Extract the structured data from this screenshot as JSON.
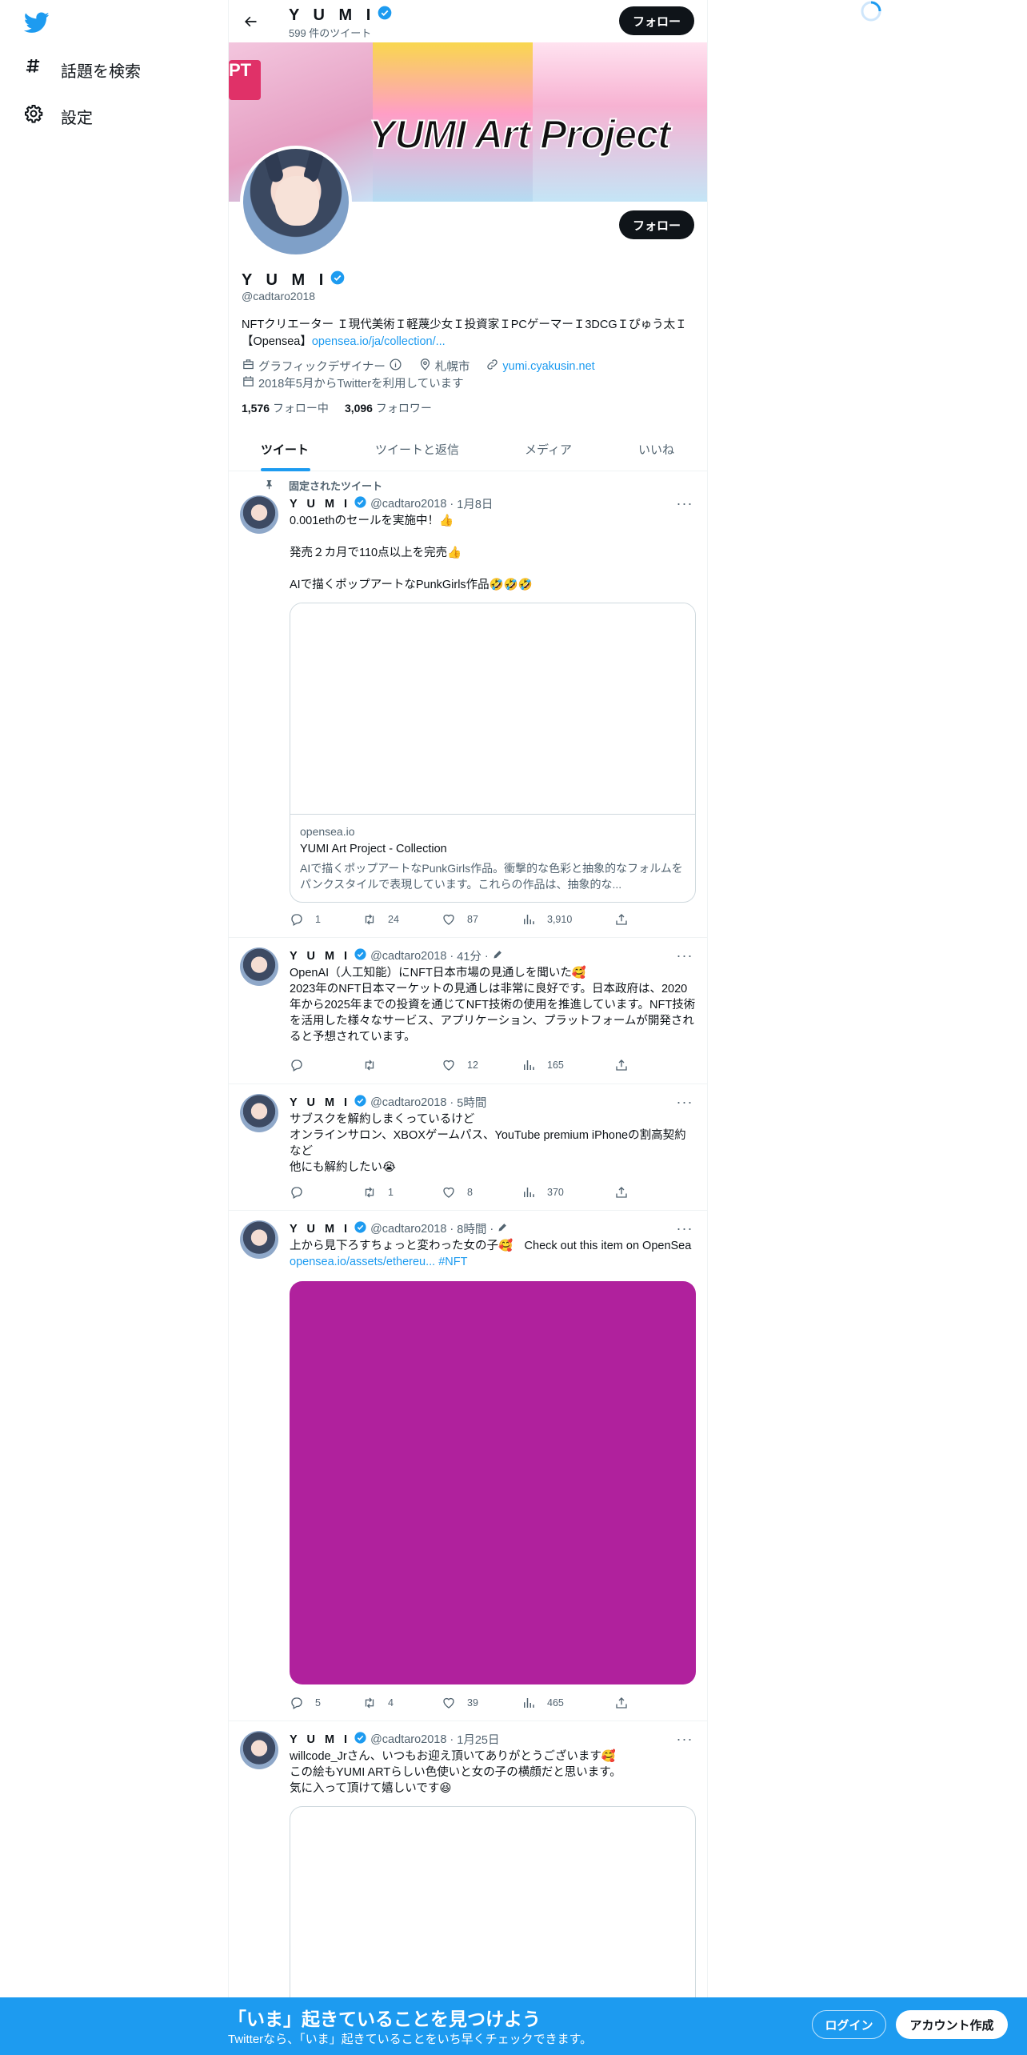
{
  "nav": {
    "explore_label": "話題を検索",
    "settings_label": "設定"
  },
  "header": {
    "name": "Y U M I",
    "tweet_count": "599 件のツイート",
    "follow_label": "フォロー"
  },
  "banner": {
    "title_text": "YUMI Art Project",
    "corner_text": "PT"
  },
  "profile": {
    "name": "Y U M I",
    "handle": "@cadtaro2018",
    "follow_label": "フォロー",
    "bio_text": "NFTクリエーター Ｉ現代美術Ｉ軽蔑少女Ｉ投資家ＩPCゲーマーＩ3DCGＩぴゅう太Ｉ【Opensea】",
    "bio_link": "opensea.io/ja/collection/...",
    "category": "グラフィックデザイナー",
    "location": "札幌市",
    "website": "yumi.cyakusin.net",
    "joined": "2018年5月からTwitterを利用しています",
    "following_count": "1,576",
    "following_label": "フォロー中",
    "followers_count": "3,096",
    "followers_label": "フォロワー"
  },
  "tabs": [
    {
      "label": "ツイート"
    },
    {
      "label": "ツイートと返信"
    },
    {
      "label": "メディア"
    },
    {
      "label": "いいね"
    }
  ],
  "tweets": [
    {
      "pinned_label": "固定されたツイート",
      "name": "Y U M I",
      "handle": "@cadtaro2018",
      "time": "1月8日",
      "text": "0.001ethのセールを実施中！👍\n\n発売２カ月で110点以上を完売👍\n\nAIで描くポップアートなPunkGirls作品🤣🤣🤣",
      "card": {
        "domain": "opensea.io",
        "title": "YUMI Art Project - Collection",
        "description": "AIで描くポップアートなPunkGirls作品。衝撃的な色彩と抽象的なフォルムをパンクスタイルで表現しています。これらの作品は、抽象的な..."
      },
      "replies": "1",
      "retweets": "24",
      "likes": "87",
      "views": "3,910"
    },
    {
      "name": "Y U M I",
      "handle": "@cadtaro2018",
      "time": "41分",
      "text": "OpenAI（人工知能）にNFT日本市場の見通しを聞いた🥰\n2023年のNFT日本マーケットの見通しは非常に良好です。日本政府は、2020年から2025年までの投資を通じてNFT技術の使用を推進しています。NFT技術を活用した様々なサービス、アプリケーション、プラットフォームが開発されると予想されています。",
      "replies": "",
      "retweets": "",
      "likes": "12",
      "views": "165"
    },
    {
      "name": "Y U M I",
      "handle": "@cadtaro2018",
      "time": "5時間",
      "text": "サブスクを解約しまくっているけど\nオンラインサロン、XBOXゲームパス、YouTube premium iPhoneの割高契約など\n他にも解約したい😭",
      "replies": "",
      "retweets": "1",
      "likes": "8",
      "views": "370"
    },
    {
      "name": "Y U M I",
      "handle": "@cadtaro2018",
      "time": "8時間",
      "text_main": "上から見下ろすちょっと変わった女の子🥰　Check out this item on OpenSea ",
      "text_link": "opensea.io/assets/ethereu...",
      "text_tag": " #NFT",
      "replies": "5",
      "retweets": "4",
      "likes": "39",
      "views": "465",
      "media_color": "#b0219d"
    },
    {
      "name": "Y U M I",
      "handle": "@cadtaro2018",
      "time": "1月25日",
      "text": "willcode_Jrさん、いつもお迎え頂いてありがとうございます🥰\nこの絵もYUMI ARTらしい色使いと女の子の横顔だと思います。\n気に入って頂けて嬉しいです😆"
    }
  ],
  "bottom_bar": {
    "title": "「いま」起きていることを見つけよう",
    "subtitle": "Twitterなら、「いま」起きていることをいち早くチェックできます。",
    "login_label": "ログイン",
    "signup_label": "アカウント作成"
  },
  "colors": {
    "accent": "#1d9bf0",
    "text": "#0f1419",
    "muted": "#536471",
    "border": "#eff3f4"
  }
}
